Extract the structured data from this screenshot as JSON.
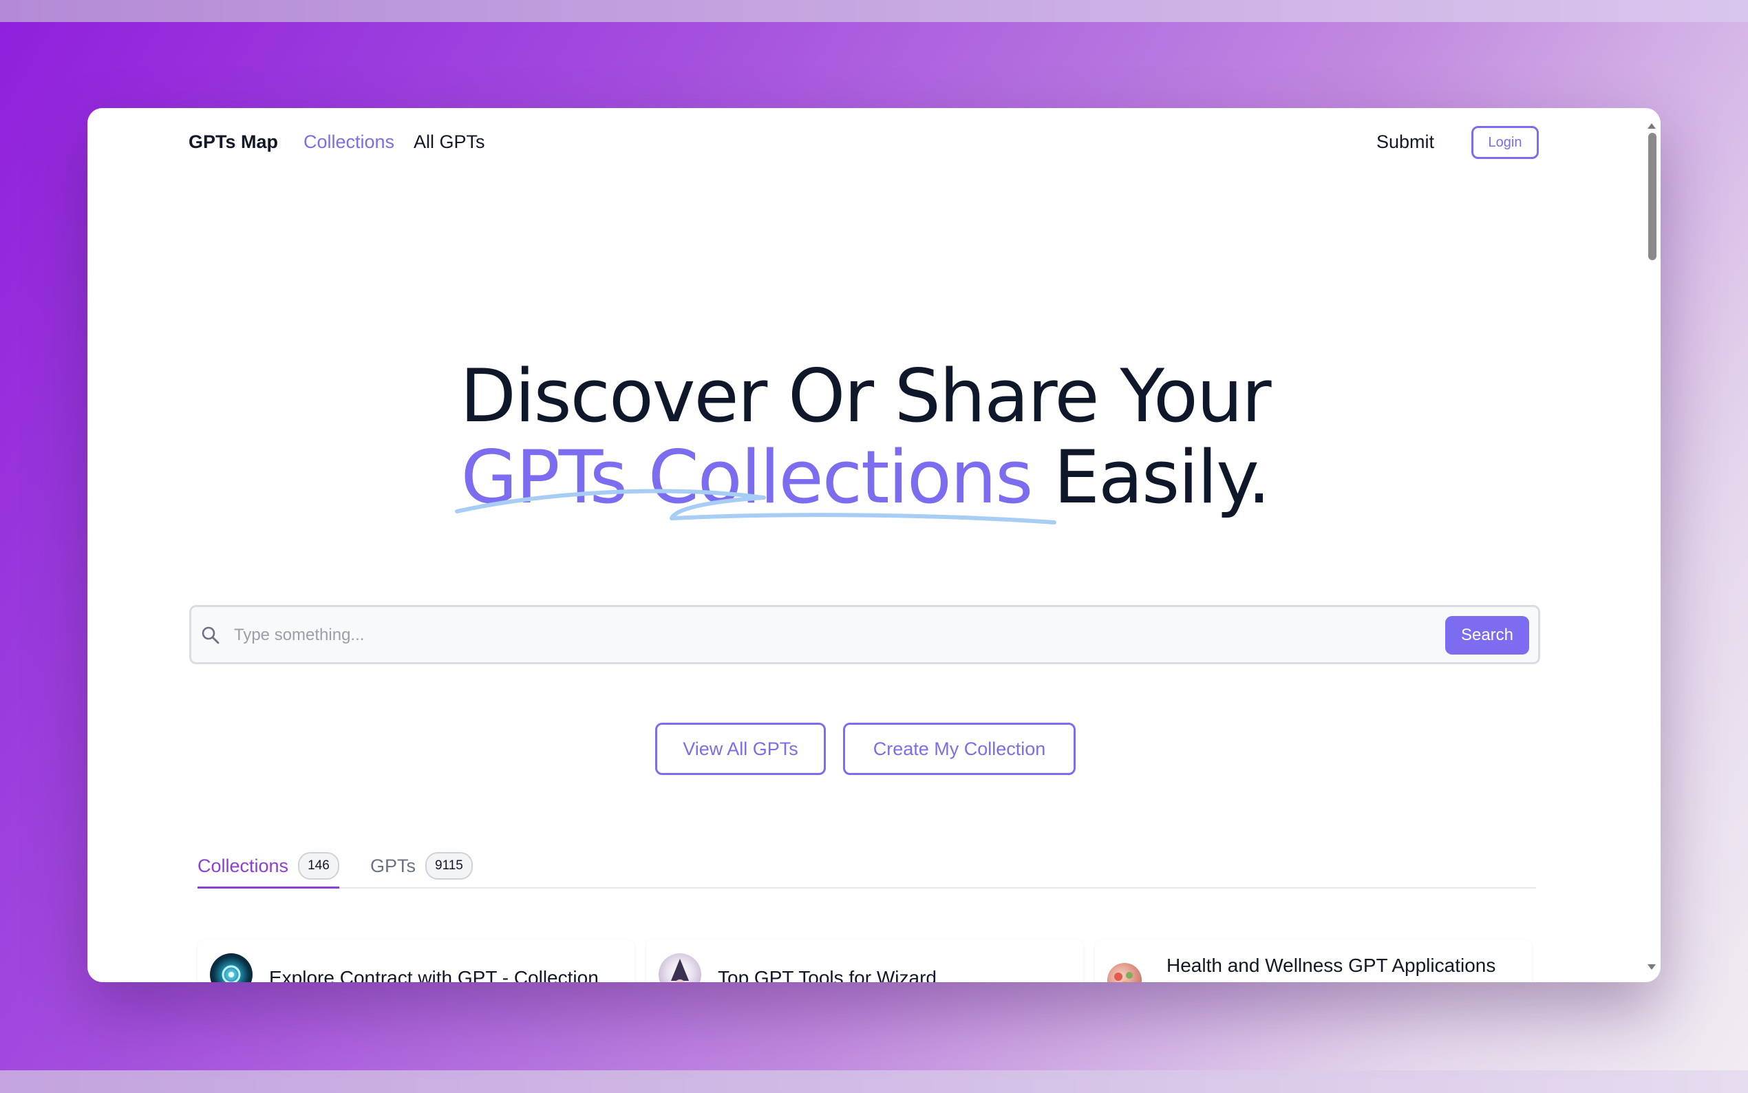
{
  "nav": {
    "brand": "GPTs Map",
    "links": [
      "Collections",
      "All GPTs"
    ],
    "active_link": "Collections",
    "submit_label": "Submit",
    "login_label": "Login"
  },
  "hero": {
    "line1": "Discover Or Share Your",
    "line2_accent": "GPTs Collections",
    "line2_rest": "Easily."
  },
  "search": {
    "placeholder": "Type something...",
    "value": "",
    "button_label": "Search",
    "icon": "search-icon"
  },
  "cta": {
    "view_all": "View All GPTs",
    "create": "Create My Collection"
  },
  "tabs": [
    {
      "label": "Collections",
      "count": "146",
      "active": true
    },
    {
      "label": "GPTs",
      "count": "9115",
      "active": false
    }
  ],
  "cards": [
    {
      "title": "Explore Contract with GPT - Collection"
    },
    {
      "title": "Top GPT Tools for Wizard"
    },
    {
      "title": "Health and Wellness GPT Applications"
    }
  ],
  "colors": {
    "accent": "#7c6cf0",
    "tab_active": "#8b3fd9",
    "heading": "#0f172a",
    "underline": "#a8cdf5"
  }
}
